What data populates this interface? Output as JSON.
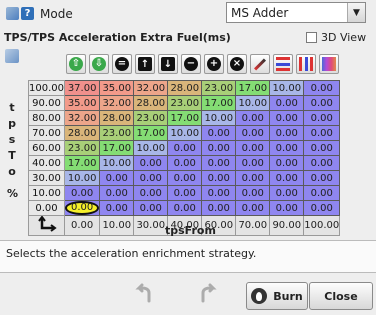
{
  "header": {
    "mode_label": "Mode",
    "mode_value": "MS Adder"
  },
  "table": {
    "title": "TPS/TPS Acceleration Extra Fuel(ms)",
    "view3d_label": "3D View",
    "y_axis_name": "tpsTo",
    "y_axis_letters": [
      "t",
      "p",
      "s",
      "T",
      "o"
    ],
    "unit_label": "%",
    "x_axis_name": "tpsFrom",
    "y_values": [
      "100.00",
      "90.00",
      "80.00",
      "70.00",
      "60.00",
      "40.00",
      "30.00",
      "10.00",
      "0.00"
    ],
    "x_values": [
      "0.00",
      "10.00",
      "30.00",
      "40.00",
      "60.00",
      "70.00",
      "90.00",
      "100.00"
    ],
    "cells": [
      [
        "37.00",
        "35.00",
        "32.00",
        "28.00",
        "23.00",
        "17.00",
        "10.00",
        "0.00"
      ],
      [
        "35.00",
        "32.00",
        "28.00",
        "23.00",
        "17.00",
        "10.00",
        "0.00",
        "0.00"
      ],
      [
        "32.00",
        "28.00",
        "23.00",
        "17.00",
        "10.00",
        "0.00",
        "0.00",
        "0.00"
      ],
      [
        "28.00",
        "23.00",
        "17.00",
        "10.00",
        "0.00",
        "0.00",
        "0.00",
        "0.00"
      ],
      [
        "23.00",
        "17.00",
        "10.00",
        "0.00",
        "0.00",
        "0.00",
        "0.00",
        "0.00"
      ],
      [
        "17.00",
        "10.00",
        "0.00",
        "0.00",
        "0.00",
        "0.00",
        "0.00",
        "0.00"
      ],
      [
        "10.00",
        "0.00",
        "0.00",
        "0.00",
        "0.00",
        "0.00",
        "0.00",
        "0.00"
      ],
      [
        "0.00",
        "0.00",
        "0.00",
        "0.00",
        "0.00",
        "0.00",
        "0.00",
        "0.00"
      ],
      [
        "0.00",
        "0.00",
        "0.00",
        "0.00",
        "0.00",
        "0.00",
        "0.00",
        "0.00"
      ]
    ],
    "selected_cell_value": "0.00",
    "colors": {
      "37.00": "#f0908c",
      "35.00": "#f29a8a",
      "32.00": "#eda58a",
      "28.00": "#d9b57a",
      "23.00": "#a8cf78",
      "17.00": "#84dd74",
      "10.00": "#a8b6e8",
      "0.00": "#8f86f0"
    }
  },
  "toolbar": {
    "icons": [
      "increment-icon",
      "decrement-icon",
      "set-equal-icon",
      "shift-up-icon",
      "shift-down-icon",
      "subtract-icon",
      "add-icon",
      "multiply-icon",
      "pen-icon",
      "horizontal-interpolate-icon",
      "vertical-interpolate-icon",
      "smooth-icon"
    ]
  },
  "help": {
    "text": "Selects the acceleration enrichment strategy."
  },
  "footer": {
    "burn_label": "Burn",
    "close_label": "Close"
  }
}
